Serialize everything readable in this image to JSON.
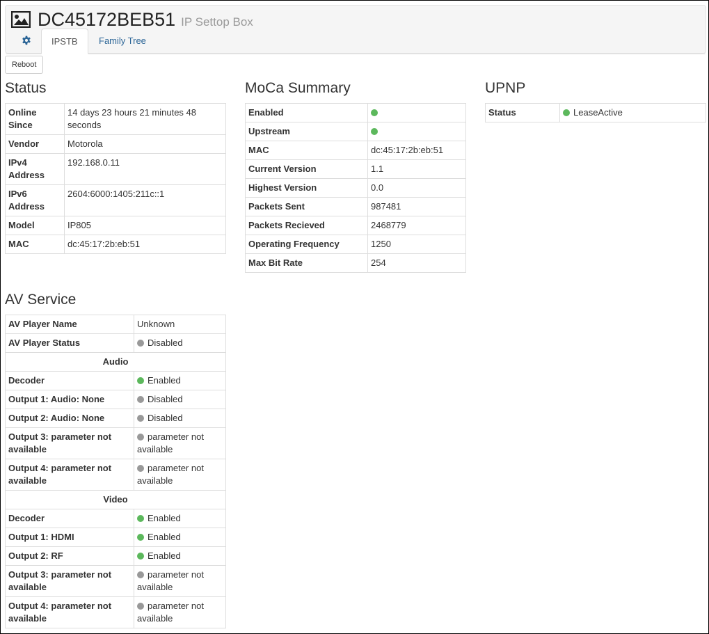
{
  "header": {
    "title": "DC45172BEB51",
    "subtitle": "IP Settop Box",
    "icon": "image-icon",
    "tabs": [
      {
        "label": "",
        "icon": "gear-icon"
      },
      {
        "label": "IPSTB"
      },
      {
        "label": "Family Tree"
      }
    ]
  },
  "toolbar": {
    "reboot_label": "Reboot"
  },
  "colors": {
    "enabled": "#5cb85c",
    "disabled": "#999999",
    "link": "#2a6496"
  },
  "status": {
    "heading": "Status",
    "rows": [
      {
        "key": "Online Since",
        "value": "14 days 23 hours 21 minutes 48 seconds"
      },
      {
        "key": "Vendor",
        "value": "Motorola"
      },
      {
        "key": "IPv4 Address",
        "value": "192.168.0.11"
      },
      {
        "key": "IPv6 Address",
        "value": "2604:6000:1405:211c::1"
      },
      {
        "key": "Model",
        "value": "IP805"
      },
      {
        "key": "MAC",
        "value": "dc:45:17:2b:eb:51"
      }
    ]
  },
  "moca": {
    "heading": "MoCa Summary",
    "rows": [
      {
        "key": "Enabled",
        "value": ""
      },
      {
        "key": "Upstream",
        "value": ""
      },
      {
        "key": "MAC",
        "value": "dc:45:17:2b:eb:51"
      },
      {
        "key": "Current Version",
        "value": "1.1"
      },
      {
        "key": "Highest Version",
        "value": "0.0"
      },
      {
        "key": "Packets Sent",
        "value": "987481"
      },
      {
        "key": "Packets Recieved",
        "value": "2468779"
      },
      {
        "key": "Operating Frequency",
        "value": "1250"
      },
      {
        "key": "Max Bit Rate",
        "value": "254"
      }
    ]
  },
  "upnp": {
    "heading": "UPNP",
    "rows": [
      {
        "key": "Status",
        "value": "LeaseActive"
      }
    ]
  },
  "av": {
    "heading": "AV Service",
    "player_name_key": "AV Player Name",
    "player_name_value": "Unknown",
    "player_status_key": "AV Player Status",
    "player_status_value": "Disabled",
    "audio_heading": "Audio",
    "audio": [
      {
        "key": "Decoder",
        "value": "Enabled"
      },
      {
        "key": "Output 1: Audio: None",
        "value": "Disabled"
      },
      {
        "key": "Output 2: Audio: None",
        "value": "Disabled"
      },
      {
        "key": "Output 3: parameter not available",
        "value": "parameter not available"
      },
      {
        "key": "Output 4: parameter not available",
        "value": "parameter not available"
      }
    ],
    "video_heading": "Video",
    "video": [
      {
        "key": "Decoder",
        "value": "Enabled"
      },
      {
        "key": "Output 1: HDMI",
        "value": "Enabled"
      },
      {
        "key": "Output 2: RF",
        "value": "Enabled"
      },
      {
        "key": "Output 3: parameter not available",
        "value": "parameter not available"
      },
      {
        "key": "Output 4: parameter not available",
        "value": "parameter not available"
      }
    ]
  }
}
